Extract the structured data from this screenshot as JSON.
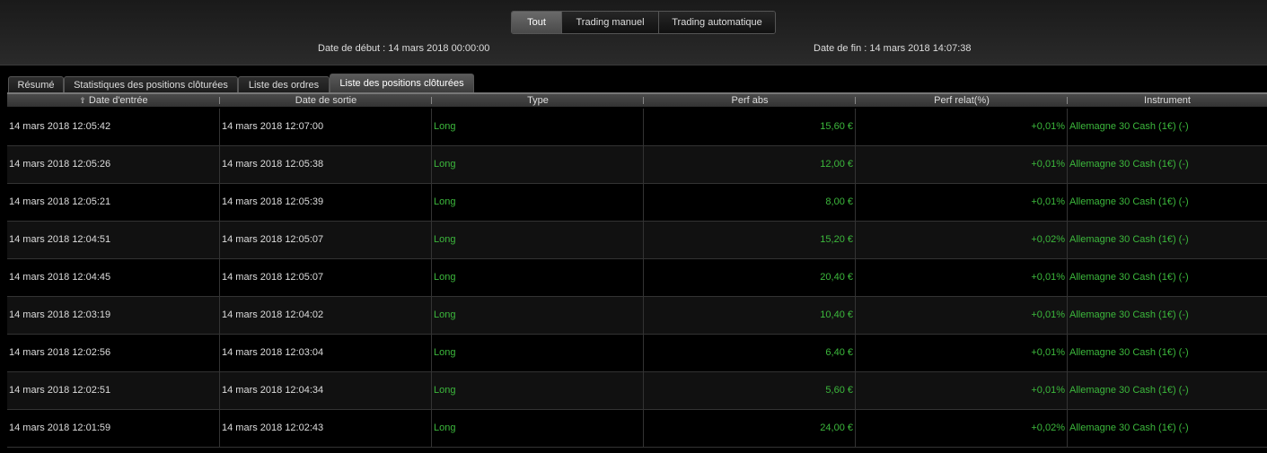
{
  "filter": {
    "buttons": [
      {
        "label": "Tout",
        "active": true
      },
      {
        "label": "Trading manuel",
        "active": false
      },
      {
        "label": "Trading automatique",
        "active": false
      }
    ]
  },
  "dates": {
    "start": "Date de début :  14 mars 2018 00:00:00",
    "end": "Date de fin :  14 mars 2018 14:07:38"
  },
  "tabs": [
    {
      "label": "Résumé",
      "active": false
    },
    {
      "label": "Statistiques des positions clôturées",
      "active": false
    },
    {
      "label": "Liste des ordres",
      "active": false
    },
    {
      "label": "Liste des positions clôturées",
      "active": true
    }
  ],
  "table": {
    "sort_icon": "sort-up-icon",
    "columns": [
      "Date d'entrée",
      "Date de sortie",
      "Type",
      "Perf abs",
      "Perf relat(%)",
      "Instrument"
    ],
    "rows": [
      [
        "14 mars 2018 12:05:42",
        "14 mars 2018 12:07:00",
        "Long",
        "15,60 €",
        "+0,01%",
        "Allemagne 30 Cash (1€) (-)"
      ],
      [
        "14 mars 2018 12:05:26",
        "14 mars 2018 12:05:38",
        "Long",
        "12,00 €",
        "+0,01%",
        "Allemagne 30 Cash (1€) (-)"
      ],
      [
        "14 mars 2018 12:05:21",
        "14 mars 2018 12:05:39",
        "Long",
        "8,00 €",
        "+0,01%",
        "Allemagne 30 Cash (1€) (-)"
      ],
      [
        "14 mars 2018 12:04:51",
        "14 mars 2018 12:05:07",
        "Long",
        "15,20 €",
        "+0,02%",
        "Allemagne 30 Cash (1€) (-)"
      ],
      [
        "14 mars 2018 12:04:45",
        "14 mars 2018 12:05:07",
        "Long",
        "20,40 €",
        "+0,01%",
        "Allemagne 30 Cash (1€) (-)"
      ],
      [
        "14 mars 2018 12:03:19",
        "14 mars 2018 12:04:02",
        "Long",
        "10,40 €",
        "+0,01%",
        "Allemagne 30 Cash (1€) (-)"
      ],
      [
        "14 mars 2018 12:02:56",
        "14 mars 2018 12:03:04",
        "Long",
        "6,40 €",
        "+0,01%",
        "Allemagne 30 Cash (1€) (-)"
      ],
      [
        "14 mars 2018 12:02:51",
        "14 mars 2018 12:04:34",
        "Long",
        "5,60 €",
        "+0,01%",
        "Allemagne 30 Cash (1€) (-)"
      ],
      [
        "14 mars 2018 12:01:59",
        "14 mars 2018 12:02:43",
        "Long",
        "24,00 €",
        "+0,02%",
        "Allemagne 30 Cash (1€) (-)"
      ]
    ]
  },
  "colors": {
    "positive": "#3cb83c",
    "background": "#000000",
    "header": "#3a3a3a"
  }
}
